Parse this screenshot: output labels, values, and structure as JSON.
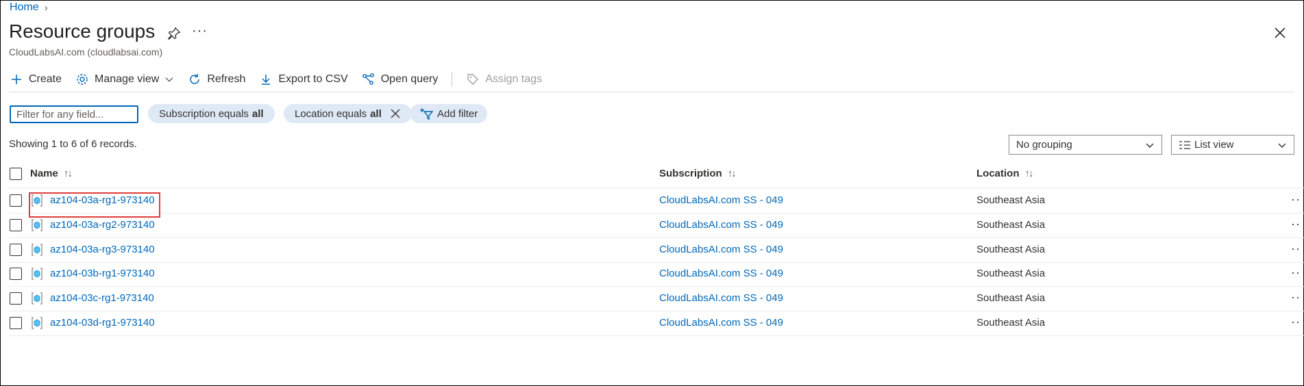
{
  "breadcrumb": {
    "home": "Home"
  },
  "header": {
    "title": "Resource groups",
    "more": "···",
    "subtitle": "CloudLabsAI.com (cloudlabsai.com)"
  },
  "toolbar": {
    "create": "Create",
    "manage_view": "Manage view",
    "refresh": "Refresh",
    "export_csv": "Export to CSV",
    "open_query": "Open query",
    "assign_tags": "Assign tags"
  },
  "filters": {
    "placeholder": "Filter for any field...",
    "subscription_label": "Subscription equals",
    "subscription_value": "all",
    "location_label": "Location equals",
    "location_value": "all",
    "add_filter": "Add filter"
  },
  "records_text": "Showing 1 to 6 of 6 records.",
  "grouping": {
    "selected": "No grouping"
  },
  "view": {
    "selected": "List view"
  },
  "table": {
    "headers": {
      "name": "Name",
      "subscription": "Subscription",
      "location": "Location",
      "sort": "↑↓"
    },
    "rows": [
      {
        "name": "az104-03a-rg1-973140",
        "subscription": "CloudLabsAI.com SS - 049",
        "location": "Southeast Asia",
        "more": "··"
      },
      {
        "name": "az104-03a-rg2-973140",
        "subscription": "CloudLabsAI.com SS - 049",
        "location": "Southeast Asia",
        "more": "··"
      },
      {
        "name": "az104-03a-rg3-973140",
        "subscription": "CloudLabsAI.com SS - 049",
        "location": "Southeast Asia",
        "more": "··"
      },
      {
        "name": "az104-03b-rg1-973140",
        "subscription": "CloudLabsAI.com SS - 049",
        "location": "Southeast Asia",
        "more": "··"
      },
      {
        "name": "az104-03c-rg1-973140",
        "subscription": "CloudLabsAI.com SS - 049",
        "location": "Southeast Asia",
        "more": "··"
      },
      {
        "name": "az104-03d-rg1-973140",
        "subscription": "CloudLabsAI.com SS - 049",
        "location": "Southeast Asia",
        "more": "··"
      }
    ]
  },
  "colors": {
    "accent": "#0067b8",
    "pill_bg": "#dfe9f5",
    "highlight": "#e03c3c"
  }
}
